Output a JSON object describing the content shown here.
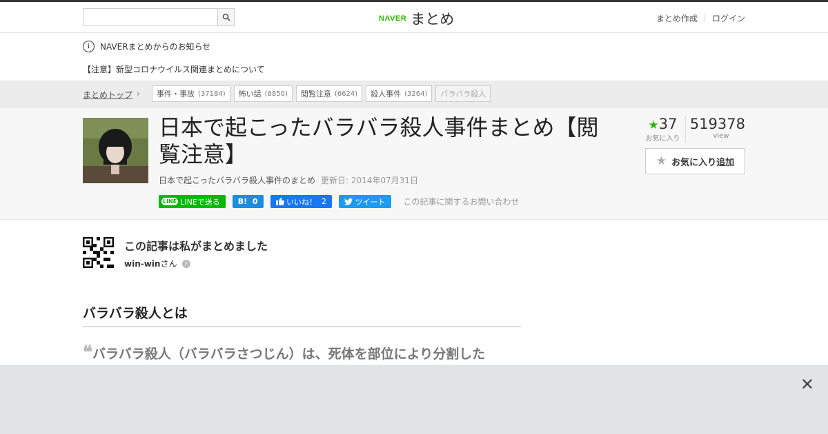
{
  "header": {
    "search_placeholder": "",
    "logo_naver": "NAVER",
    "logo_matome": "まとめ",
    "create_link": "まとめ作成",
    "login_link": "ログイン"
  },
  "notice": {
    "info_glyph": "i",
    "title": "NAVERまとめからのお知らせ",
    "item": "【注意】新型コロナウイルス関連まとめについて"
  },
  "breadcrumb": {
    "home": "まとめトップ",
    "chevron": "›",
    "tags": [
      {
        "label": "事件・事故",
        "count": "(37184)"
      },
      {
        "label": "怖い話",
        "count": "(8850)"
      },
      {
        "label": "閲覧注意",
        "count": "(6624)"
      },
      {
        "label": "殺人事件",
        "count": "(3264)"
      },
      {
        "label": "バラバラ殺人",
        "count": ""
      }
    ]
  },
  "article": {
    "title": "日本で起こったバラバラ殺人事件まとめ【閲覧注意】",
    "description": "日本で起こったバラバラ殺人事件のまとめ",
    "updated": "更新日: 2014年07月31日",
    "favorites": "37",
    "favorites_label": "お気に入り",
    "views": "519378",
    "views_label": "view",
    "add_favorite": "お気に入り追加",
    "contact": "この記事に関するお問い合わせ"
  },
  "share": {
    "line_icon": "LINE",
    "line": "LINEで送る",
    "hatena_icon": "B!",
    "hatena_count": "0",
    "fb_label": "いいね！",
    "fb_count": "2",
    "tweet": "ツイート"
  },
  "author": {
    "heading": "この記事は私がまとめました",
    "name": "win-win",
    "suffix": "さん"
  },
  "content": {
    "section_title": "バラバラ殺人とは",
    "quote_mark": "❝",
    "quote": "バラバラ殺人（バラバラさつじん）は、死体を部位により分割した"
  },
  "colors": {
    "accent": "#2db400",
    "line": "#00b900",
    "facebook": "#1877f2",
    "twitter": "#1d9bf0"
  },
  "icons": [
    "search-icon",
    "info-icon",
    "chevron-right-icon",
    "star-icon",
    "line-icon",
    "hatena-icon",
    "facebook-like-icon",
    "twitter-icon",
    "qr-code-icon",
    "verified-icon",
    "close-icon"
  ]
}
